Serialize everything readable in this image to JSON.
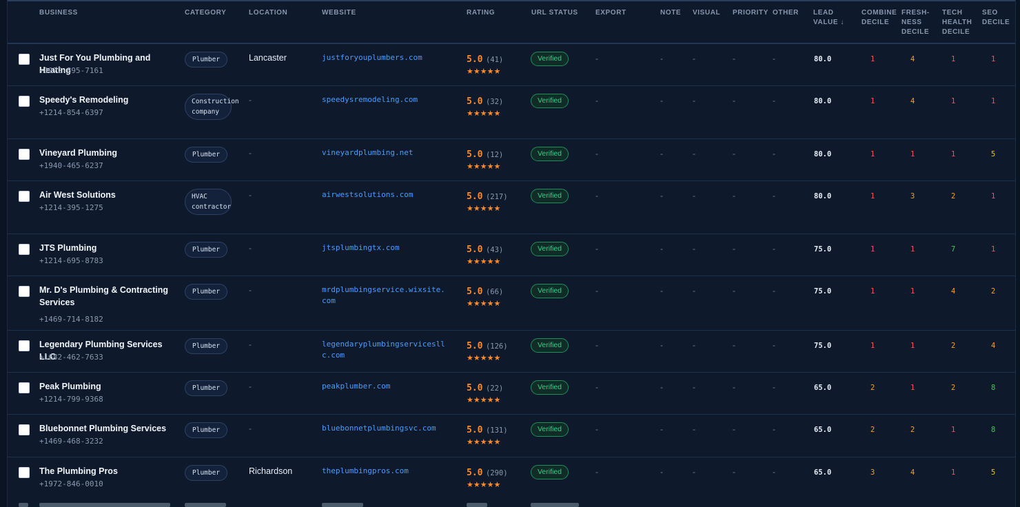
{
  "columns": {
    "business": "BUSINESS",
    "category": "CATEGORY",
    "location": "LOCATION",
    "website": "WEBSITE",
    "rating": "RATING",
    "url_status": "URL STATUS",
    "export": "EXPORT",
    "note": "NOTE",
    "visual": "VISUAL",
    "priority": "PRIORITY",
    "other": "OTHER",
    "lead_value": "LEAD VALUE ↓",
    "combine_decile": "COMBINE DECILE",
    "freshness_decile": "FRESH- NESS DECILE",
    "tech_health_decile": "TECH HEALTH DECILE",
    "seo_decile": "SEO DECILE"
  },
  "placeholder_dash": "-",
  "stars": "★★★★★",
  "colors": {
    "decile_1": "#ff4d5e",
    "decile_2_4": "#ff9f1a",
    "decile_5": "#f5c400",
    "decile_7_8": "#3ccf4e",
    "rating": "#ff8a2a",
    "verified": "#35d18b",
    "link": "#4a9cff"
  },
  "rows": [
    {
      "name": "Just For You Plumbing and Heating",
      "phone": "+1972-895-7161",
      "category": "Plumber",
      "location": "Lancaster",
      "website": "justforyouplumbers.com",
      "rating": "5.0",
      "reviews": "(41)",
      "status": "Verified",
      "lead": "80.0",
      "combine": "1",
      "freshness": "4",
      "tech": "1",
      "seo": "1"
    },
    {
      "name": "Speedy's Remodeling",
      "phone": "+1214-854-6397",
      "category": "Construction company",
      "location": "-",
      "website": "speedysremodeling.com",
      "rating": "5.0",
      "reviews": "(32)",
      "status": "Verified",
      "lead": "80.0",
      "combine": "1",
      "freshness": "4",
      "tech": "1",
      "seo": "1"
    },
    {
      "name": "Vineyard Plumbing",
      "phone": "+1940-465-6237",
      "category": "Plumber",
      "location": "-",
      "website": "vineyardplumbing.net",
      "rating": "5.0",
      "reviews": "(12)",
      "status": "Verified",
      "lead": "80.0",
      "combine": "1",
      "freshness": "1",
      "tech": "1",
      "seo": "5"
    },
    {
      "name": "Air West Solutions",
      "phone": "+1214-395-1275",
      "category": "HVAC contractor",
      "location": "-",
      "website": "airwestsolutions.com",
      "rating": "5.0",
      "reviews": "(217)",
      "status": "Verified",
      "lead": "80.0",
      "combine": "1",
      "freshness": "3",
      "tech": "2",
      "seo": "1"
    },
    {
      "name": "JTS Plumbing",
      "phone": "+1214-695-8783",
      "category": "Plumber",
      "location": "-",
      "website": "jtsplumbingtx.com",
      "rating": "5.0",
      "reviews": "(43)",
      "status": "Verified",
      "lead": "75.0",
      "combine": "1",
      "freshness": "1",
      "tech": "7",
      "seo": "1"
    },
    {
      "name": "Mr. D's Plumbing & Contracting Services",
      "phone": "+1469-714-8182",
      "category": "Plumber",
      "location": "-",
      "website": "mrdplumbingservice.wixsite.com",
      "rating": "5.0",
      "reviews": "(66)",
      "status": "Verified",
      "lead": "75.0",
      "combine": "1",
      "freshness": "1",
      "tech": "4",
      "seo": "2"
    },
    {
      "name": "Legendary Plumbing Services LLC",
      "phone": "+1682-462-7633",
      "category": "Plumber",
      "location": "-",
      "website": "legendaryplumbingservicesllc.com",
      "rating": "5.0",
      "reviews": "(126)",
      "status": "Verified",
      "lead": "75.0",
      "combine": "1",
      "freshness": "1",
      "tech": "2",
      "seo": "4"
    },
    {
      "name": "Peak Plumbing",
      "phone": "+1214-799-9368",
      "category": "Plumber",
      "location": "-",
      "website": "peakplumber.com",
      "rating": "5.0",
      "reviews": "(22)",
      "status": "Verified",
      "lead": "65.0",
      "combine": "2",
      "freshness": "1",
      "tech": "2",
      "seo": "8"
    },
    {
      "name": "Bluebonnet Plumbing Services",
      "phone": "+1469-468-3232",
      "category": "Plumber",
      "location": "-",
      "website": "bluebonnetplumbingsvc.com",
      "rating": "5.0",
      "reviews": "(131)",
      "status": "Verified",
      "lead": "65.0",
      "combine": "2",
      "freshness": "2",
      "tech": "1",
      "seo": "8"
    },
    {
      "name": "The Plumbing Pros",
      "phone": "+1972-846-0010",
      "category": "Plumber",
      "location": "Richardson",
      "website": "theplumbingpros.com",
      "rating": "5.0",
      "reviews": "(290)",
      "status": "Verified",
      "lead": "65.0",
      "combine": "3",
      "freshness": "4",
      "tech": "1",
      "seo": "5"
    }
  ]
}
